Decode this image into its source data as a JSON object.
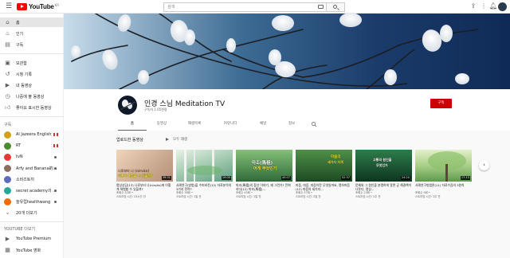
{
  "topbar": {
    "logo_text": "YouTube",
    "logo_region": "KR",
    "search_placeholder": "검색"
  },
  "sidebar": {
    "main": [
      {
        "label": "홈",
        "icon": "home-icon"
      },
      {
        "label": "인기",
        "icon": "trending-icon"
      },
      {
        "label": "구독",
        "icon": "subscriptions-icon"
      }
    ],
    "library": [
      {
        "label": "보관함",
        "icon": "library-icon"
      },
      {
        "label": "시청 기록",
        "icon": "history-icon"
      },
      {
        "label": "내 동영상",
        "icon": "my-videos-icon"
      },
      {
        "label": "나중에 볼 동영상",
        "icon": "watch-later-icon"
      },
      {
        "label": "좋아요 표시한 동영상",
        "icon": "liked-icon"
      }
    ],
    "subscriptions_heading": "구독",
    "subscriptions": [
      {
        "label": "Al Jazeera English",
        "color": "#d4a017",
        "flag": true
      },
      {
        "label": "RT",
        "color": "#4c8c2b",
        "flag": true
      },
      {
        "label": "tvN",
        "color": "#e53935",
        "dot": true
      },
      {
        "label": "Arfy and Banana的...",
        "color": "#8d6e63",
        "dot": true
      },
      {
        "label": "소비즈토끼",
        "color": "#5c6bc0",
        "flag": false
      },
      {
        "label": "secret academy의 ...",
        "color": "#26a69a",
        "dot": true
      },
      {
        "label": "놀유럽healthwang",
        "color": "#ef6c00",
        "dot": true
      },
      {
        "label": "20개 더보기",
        "icon": "expand-icon"
      }
    ],
    "more_heading": "YOUTUBE 더보기",
    "more": [
      {
        "label": "YouTube Premium",
        "icon": "premium-icon"
      },
      {
        "label": "YouTube 영화",
        "icon": "movies-icon"
      }
    ]
  },
  "channel": {
    "name": "인경 스님 Meditation TV",
    "subscribers": "구독자 1.05천명",
    "subscribe_label": "구독",
    "tabs": [
      "홈",
      "동영상",
      "재생목록",
      "커뮤니티",
      "채널",
      "정보"
    ]
  },
  "uploads": {
    "title": "업로드한 동영상",
    "play_all": "모두 재생",
    "videos": [
      {
        "title": "명상상담(13) 나로부터 나(nirvān)에 이렇게 체험할 수 있을까?",
        "views": "조회수 32회 •",
        "age": "스트리밍 시간: 23시간 전",
        "duration": "39:31",
        "overlay": "나로부터 나 (nirvān)",
        "overlay2": "어떻게 체험할 수 있을까?",
        "c1": "#e8c6a8",
        "c2": "#b48e77"
      },
      {
        "title": "사례연구(방법)을 수피비전(12) 자료분석의 3가지 전략?",
        "views": "조회수 16회 •",
        "age": "스트리밍 시간: 1일 전",
        "duration": "19:05",
        "overlay": "",
        "overlay2": "",
        "c1": "#cfe3d1",
        "c2": "#7fa99a"
      },
      {
        "title": "마조(馬祖)의 참선 이야기, 왜 그런가? 깐희리다(12) 마조(馬祖)...",
        "views": "조회수 45회 •",
        "age": "스트리밍 시간: 1일 전",
        "duration": "45:07",
        "overlay": "마조(馬祖)",
        "overlay2": "어게 무엇인가",
        "c1": "#6fa86a",
        "c2": "#2f6a3a"
      },
      {
        "title": "마음, 마음, 마음이란 무엇일까요, 명하마음(12) 마음의 세가지...",
        "views": "조회수 57회 •",
        "age": "스트리밍 시간: 2일 전",
        "duration": "52:37",
        "overlay": "마음의",
        "overlay2": "세가지 자격",
        "c1": "#3f7f3b",
        "c2": "#1d4a23"
      },
      {
        "title": "문제와 그 원인을 분명하게 알면 곧 해결책이 나온다, 명상...",
        "views": "조회수 23회 •",
        "age": "스트리밍 시간: 1주 전",
        "duration": "24:20",
        "overlay": "고통의 원인을",
        "overlay2": "무엇인가",
        "c1": "#1e5a35",
        "c2": "#0d3520"
      },
      {
        "title": "사례연구방법론(11) 자료수집의 3원칙",
        "views": "조회수 9회 •",
        "age": "스트리밍 시간: 1주 전",
        "duration": "17:15",
        "overlay": "",
        "overlay2": "",
        "c1": "#cde2a8",
        "c2": "#5d9a4b"
      }
    ]
  },
  "colors": {
    "brand_red": "#ff0000",
    "subscribe_red": "#cc0000"
  }
}
